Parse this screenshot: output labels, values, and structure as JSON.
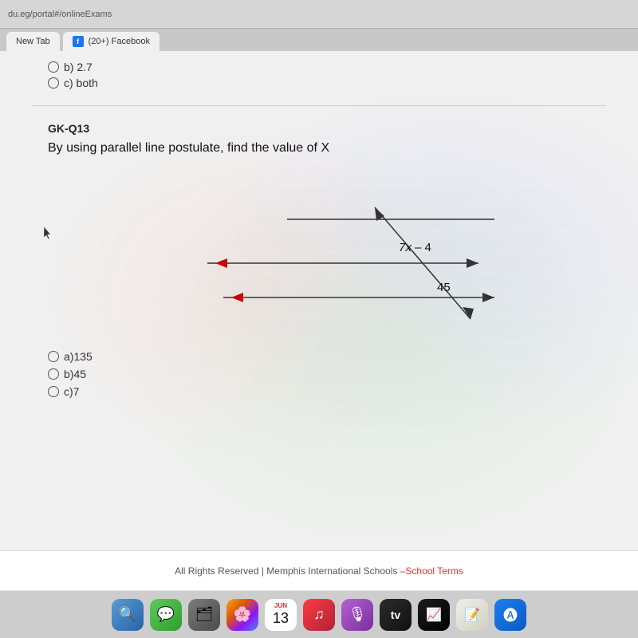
{
  "browser": {
    "url": "du.eg/portal#/onlineExams",
    "tabs": [
      {
        "label": "New Tab"
      },
      {
        "label": "(20+) Facebook",
        "icon": "fb"
      }
    ]
  },
  "prev_question": {
    "options": [
      {
        "label": "b) 2.7",
        "strikethrough": false
      },
      {
        "label": "c) both",
        "strikethrough": false
      }
    ]
  },
  "question": {
    "id": "GK-Q13",
    "text": "By using parallel line postulate, find the value of X",
    "diagram": {
      "label1": "7x – 4",
      "label2": "45"
    },
    "answers": [
      {
        "label": "a)135"
      },
      {
        "label": "b)45"
      },
      {
        "label": "c)7"
      }
    ]
  },
  "footer": {
    "text": "All Rights Reserved | Memphis International Schools – ",
    "link_label": "School Terms"
  },
  "dock": {
    "date_month": "JUN",
    "date_day": "13",
    "items": [
      "finder",
      "messages",
      "finder2",
      "photos",
      "music",
      "podcast",
      "appletv",
      "stocks",
      "textedit",
      "appstore"
    ]
  },
  "cursor": {
    "visible": true
  }
}
